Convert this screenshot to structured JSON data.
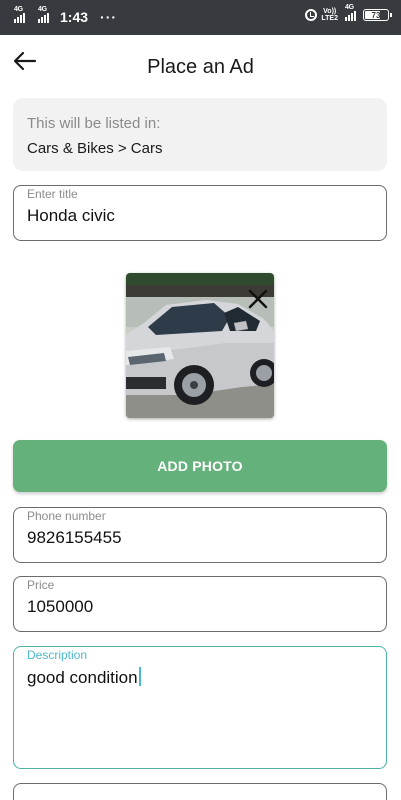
{
  "status_bar": {
    "network_1": "4G",
    "network_2": "4G",
    "time": "1:43",
    "overflow": "···",
    "volte_line1": "Vo))",
    "volte_line2": "LTE2",
    "network_3": "4G",
    "battery_level": 73,
    "battery_text": "73"
  },
  "header": {
    "back_icon": "arrow-left-icon",
    "title": "Place an Ad"
  },
  "category": {
    "caption": "This will be listed in:",
    "path": "Cars & Bikes > Cars"
  },
  "form": {
    "title_field": {
      "label": "Enter title",
      "value": "Honda civic"
    },
    "photo": {
      "alt": "Silver Honda Civic car photo",
      "remove_icon": "close-icon"
    },
    "add_photo_label": "ADD PHOTO",
    "phone_field": {
      "label": "Phone number",
      "value": "9826155455"
    },
    "price_field": {
      "label": "Price",
      "value": "1050000"
    },
    "description_field": {
      "label": "Description",
      "value": "good condition"
    }
  },
  "colors": {
    "status_bar_bg": "#373a3e",
    "accent_green": "#65b17b",
    "focus_teal": "#4fb8cc",
    "category_bg": "#f2f2f2"
  }
}
